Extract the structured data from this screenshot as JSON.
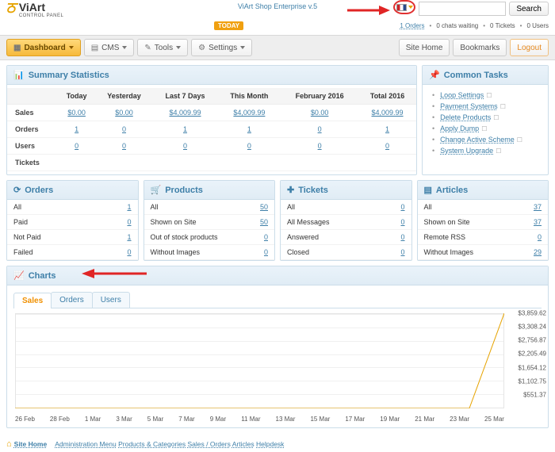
{
  "app": {
    "name": "ViArt",
    "subtitle": "CONTROL PANEL",
    "edition": "ViArt Shop Enterprise v.5",
    "search_placeholder": "",
    "search_button": "Search"
  },
  "status": {
    "today_label": "TODAY",
    "orders_link": "1 Orders",
    "items": [
      "0 chats waiting",
      "0 Tickets",
      "0 Users"
    ]
  },
  "nav": {
    "dashboard": "Dashboard",
    "cms": "CMS",
    "tools": "Tools",
    "settings": "Settings",
    "site_home": "Site Home",
    "bookmarks": "Bookmarks",
    "logout": "Logout"
  },
  "summary": {
    "title": "Summary Statistics",
    "cols": [
      "",
      "Today",
      "Yesterday",
      "Last 7 Days",
      "This Month",
      "February 2016",
      "Total 2016"
    ],
    "rows": [
      {
        "label": "Sales",
        "cells": [
          "$0.00",
          "$0.00",
          "$4,009.99",
          "$4,009.99",
          "$0.00",
          "$4,009.99"
        ]
      },
      {
        "label": "Orders",
        "cells": [
          "1",
          "0",
          "1",
          "1",
          "0",
          "1"
        ]
      },
      {
        "label": "Users",
        "cells": [
          "0",
          "0",
          "0",
          "0",
          "0",
          "0"
        ]
      },
      {
        "label": "Tickets",
        "cells": [
          "",
          "",
          "",
          "",
          "",
          ""
        ]
      }
    ]
  },
  "common_tasks": {
    "title": "Common Tasks",
    "items": [
      "Loop Settings",
      "Payment Systems",
      "Delete Products",
      "Apply Dump",
      "Change Active Scheme",
      "System Upgrade"
    ]
  },
  "mini": {
    "orders": {
      "title": "Orders",
      "rows": [
        [
          "All",
          "1"
        ],
        [
          "Paid",
          "0"
        ],
        [
          "Not Paid",
          "1"
        ],
        [
          "Failed",
          "0"
        ]
      ]
    },
    "products": {
      "title": "Products",
      "rows": [
        [
          "All",
          "50"
        ],
        [
          "Shown on Site",
          "50"
        ],
        [
          "Out of stock products",
          "0"
        ],
        [
          "Without Images",
          "0"
        ]
      ]
    },
    "tickets": {
      "title": "Tickets",
      "rows": [
        [
          "All",
          "0"
        ],
        [
          "All Messages",
          "0"
        ],
        [
          "Answered",
          "0"
        ],
        [
          "Closed",
          "0"
        ]
      ]
    },
    "articles": {
      "title": "Articles",
      "rows": [
        [
          "All",
          "37"
        ],
        [
          "Shown on Site",
          "37"
        ],
        [
          "Remote RSS",
          "0"
        ],
        [
          "Without Images",
          "29"
        ]
      ]
    }
  },
  "charts": {
    "title": "Charts",
    "tabs": [
      "Sales",
      "Orders",
      "Users"
    ],
    "active_tab": "Sales"
  },
  "chart_data": {
    "type": "line",
    "title": "Sales",
    "xlabel": "",
    "ylabel": "",
    "x": [
      "26 Feb",
      "28 Feb",
      "1 Mar",
      "3 Mar",
      "5 Mar",
      "7 Mar",
      "9 Mar",
      "11 Mar",
      "13 Mar",
      "15 Mar",
      "17 Mar",
      "19 Mar",
      "21 Mar",
      "23 Mar",
      "25 Mar"
    ],
    "y": [
      0,
      0,
      0,
      0,
      0,
      0,
      0,
      0,
      0,
      0,
      0,
      0,
      0,
      0,
      4009.99
    ],
    "y_ticks": [
      "$3,859.62",
      "$3,308.24",
      "$2,756.87",
      "$2,205.49",
      "$1,654.12",
      "$1,102.75",
      "$551.37"
    ],
    "ylim": [
      0,
      4009.99
    ]
  },
  "footer": {
    "site_home": "Site Home",
    "links": [
      "Administration Menu",
      "Products & Categories",
      "Sales / Orders",
      "Articles",
      "Helpdesk"
    ]
  }
}
